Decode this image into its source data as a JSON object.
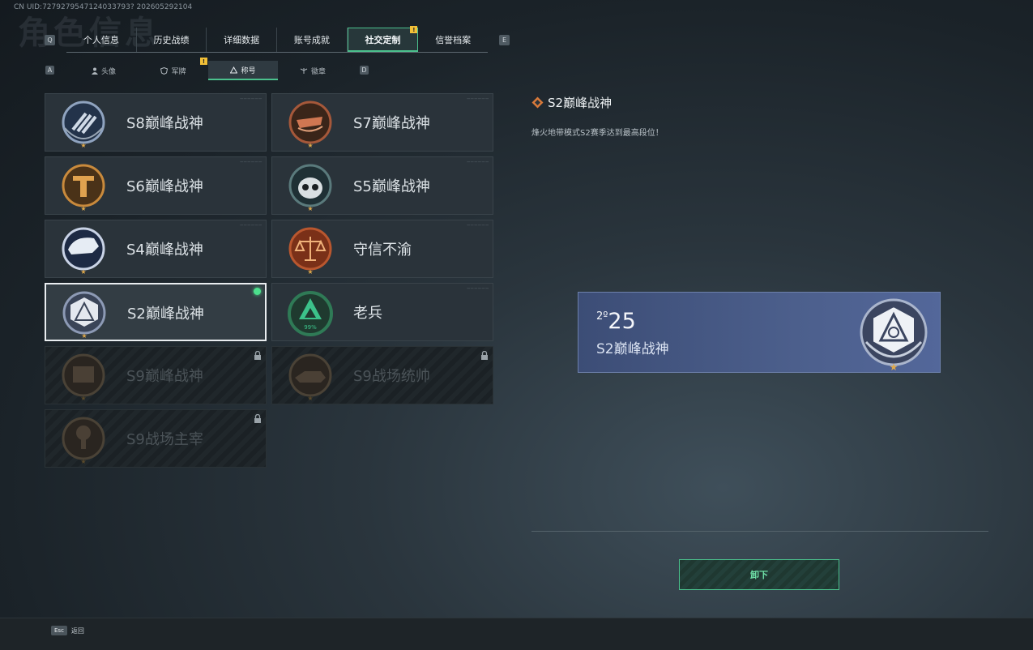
{
  "uid": "CN UID:7279279547124033793? 202605292104",
  "page_title_watermark": "角色信息",
  "nav": {
    "left_key": "Q",
    "right_key": "E",
    "tabs": [
      {
        "label": "个人信息",
        "active": false
      },
      {
        "label": "历史战绩",
        "active": false
      },
      {
        "label": "详细数据",
        "active": false
      },
      {
        "label": "账号成就",
        "active": false
      },
      {
        "label": "社交定制",
        "active": true,
        "badge": "!"
      },
      {
        "label": "信誉档案",
        "active": false
      }
    ]
  },
  "subnav": {
    "left_key": "A",
    "right_key": "D",
    "tabs": [
      {
        "label": "头像",
        "icon": "person-icon"
      },
      {
        "label": "军牌",
        "icon": "shield-icon",
        "badge": "!"
      },
      {
        "label": "称号",
        "icon": "triangle-icon",
        "active": true
      },
      {
        "label": "徽章",
        "icon": "wings-icon"
      }
    ]
  },
  "titles": [
    {
      "label": "S8巅峰战神",
      "icon": "s8-emblem-icon",
      "state": "normal"
    },
    {
      "label": "S7巅峰战神",
      "icon": "s7-emblem-icon",
      "state": "normal"
    },
    {
      "label": "S6巅峰战神",
      "icon": "s6-emblem-icon",
      "state": "normal"
    },
    {
      "label": "S5巅峰战神",
      "icon": "s5-emblem-icon",
      "state": "normal"
    },
    {
      "label": "S4巅峰战神",
      "icon": "s4-emblem-icon",
      "state": "normal"
    },
    {
      "label": "守信不渝",
      "icon": "scales-emblem-icon",
      "state": "normal"
    },
    {
      "label": "S2巅峰战神",
      "icon": "s2-emblem-icon",
      "state": "selected"
    },
    {
      "label": "老兵",
      "icon": "veteran-emblem-icon",
      "state": "normal",
      "percent": "99%"
    },
    {
      "label": "S9巅峰战神",
      "icon": "s9-emblem-icon",
      "state": "locked"
    },
    {
      "label": "S9战场统帅",
      "icon": "s9-commander-emblem-icon",
      "state": "locked"
    },
    {
      "label": "S9战场主宰",
      "icon": "s9-dominator-emblem-icon",
      "state": "locked"
    }
  ],
  "detail": {
    "title": "S2巅峰战神",
    "description": "烽火地带模式S2赛季达到最高段位！",
    "preview_year_prefix": "2º",
    "preview_year": "25",
    "preview_title": "S2巅峰战神",
    "button_label": "卸下"
  },
  "footer": {
    "key": "Esc",
    "label": "返回"
  },
  "colors": {
    "accent_green": "#4bc18d",
    "badge_yellow": "#f2c037",
    "preview_blue": "#4c5f8c"
  }
}
